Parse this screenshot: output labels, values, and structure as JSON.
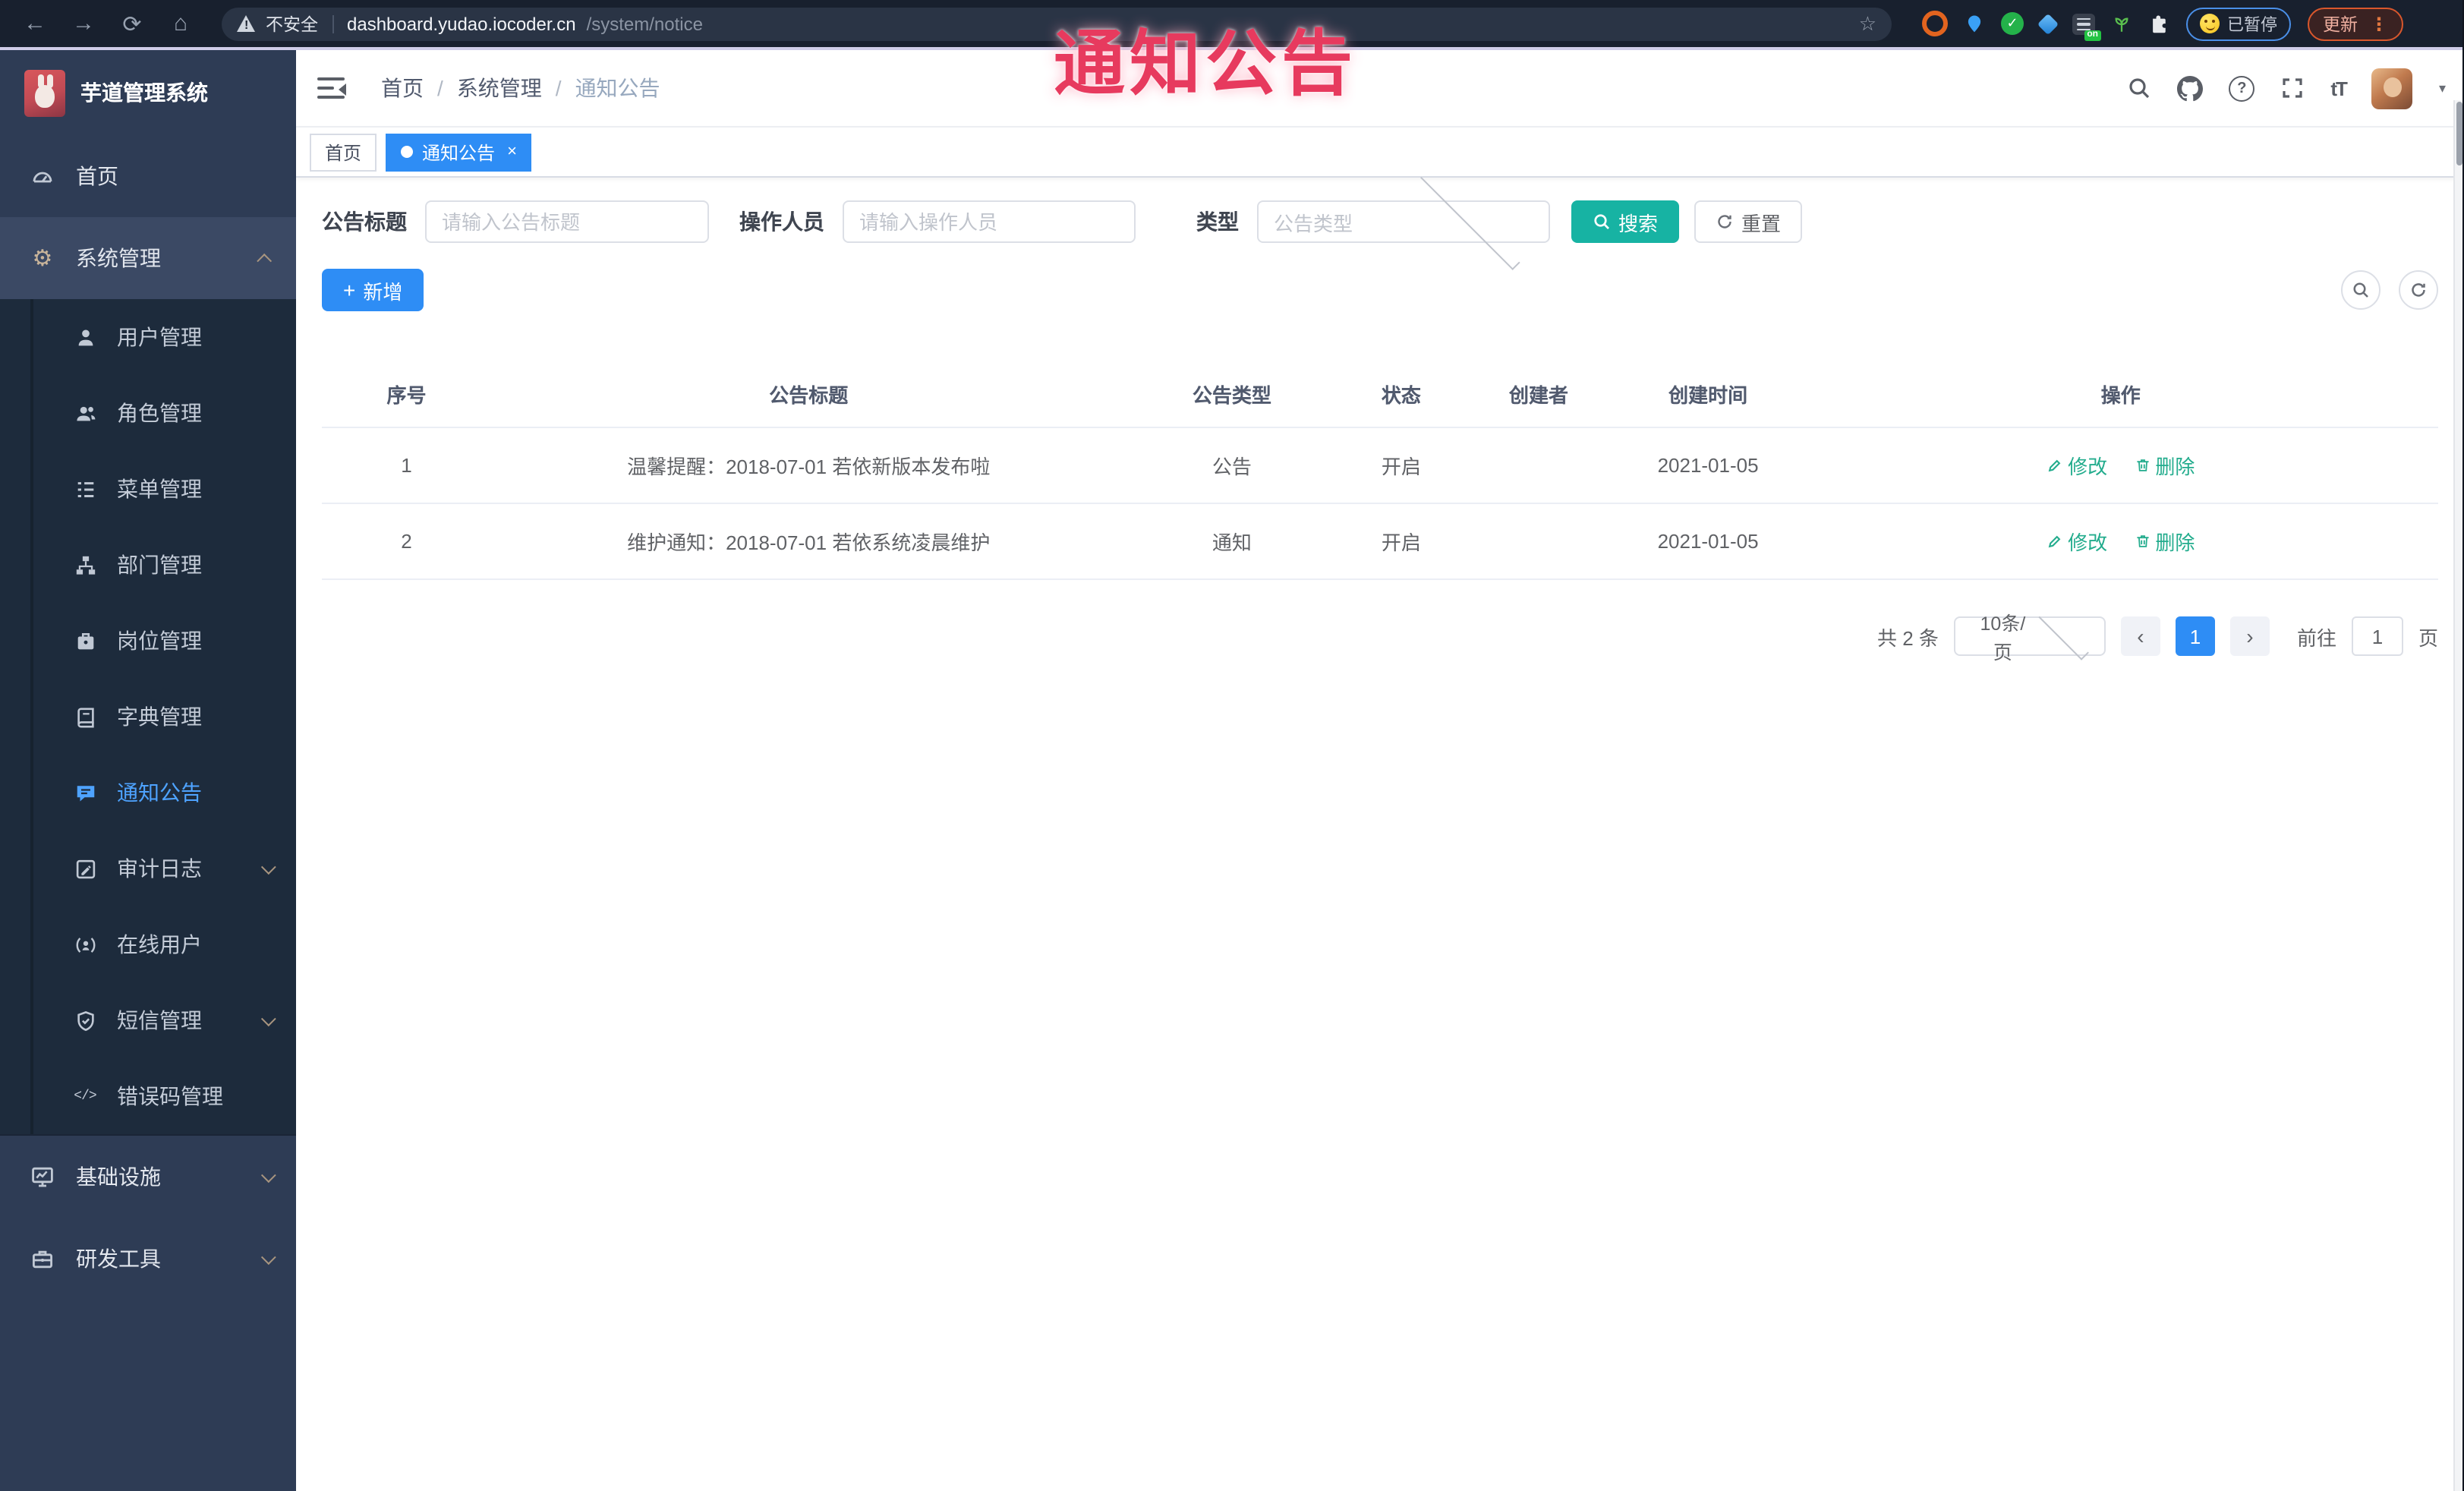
{
  "overlay": {
    "title": "通知公告"
  },
  "browser": {
    "security_label": "不安全",
    "url_host": "dashboard.yudao.iocoder.cn",
    "url_path": "/system/notice",
    "extension_on_badge": "on",
    "paused_label": "已暂停",
    "update_label": "更新"
  },
  "sidebar": {
    "app_title": "芋道管理系统",
    "items": [
      {
        "label": "首页"
      },
      {
        "label": "系统管理"
      },
      {
        "label": "用户管理"
      },
      {
        "label": "角色管理"
      },
      {
        "label": "菜单管理"
      },
      {
        "label": "部门管理"
      },
      {
        "label": "岗位管理"
      },
      {
        "label": "字典管理"
      },
      {
        "label": "通知公告"
      },
      {
        "label": "审计日志"
      },
      {
        "label": "在线用户"
      },
      {
        "label": "短信管理"
      },
      {
        "label": "错误码管理"
      },
      {
        "label": "基础设施"
      },
      {
        "label": "研发工具"
      }
    ]
  },
  "header": {
    "breadcrumb": [
      "首页",
      "系统管理",
      "通知公告"
    ]
  },
  "tabs": [
    {
      "label": "首页"
    },
    {
      "label": "通知公告",
      "close": "×"
    }
  ],
  "filters": {
    "title_label": "公告标题",
    "title_placeholder": "请输入公告标题",
    "operator_label": "操作人员",
    "operator_placeholder": "请输入操作人员",
    "type_label": "类型",
    "type_placeholder": "公告类型",
    "search_label": "搜索",
    "reset_label": "重置"
  },
  "toolbar": {
    "add_label": "新增"
  },
  "table": {
    "headers": [
      "序号",
      "公告标题",
      "公告类型",
      "状态",
      "创建者",
      "创建时间",
      "操作"
    ],
    "rows": [
      {
        "no": "1",
        "title": "温馨提醒：2018-07-01 若依新版本发布啦",
        "type": "公告",
        "status": "开启",
        "creator": "",
        "created": "2021-01-05",
        "edit": "修改",
        "delete": "删除"
      },
      {
        "no": "2",
        "title": "维护通知：2018-07-01 若依系统凌晨维护",
        "type": "通知",
        "status": "开启",
        "creator": "",
        "created": "2021-01-05",
        "edit": "修改",
        "delete": "删除"
      }
    ]
  },
  "pagination": {
    "total": "共 2 条",
    "page_size": "10条/页",
    "prev": "‹",
    "current": "1",
    "next": "›",
    "goto_label": "前往",
    "goto_value": "1",
    "goto_unit": "页"
  },
  "colors": {
    "primary_blue": "#2e8df5",
    "teal": "#17b3a3",
    "op_link_teal": "#23ac8d",
    "overlay_red": "#e73a5e",
    "sidebar_bg": "#2e3c55",
    "submenu_bg": "#1d2b3c"
  }
}
